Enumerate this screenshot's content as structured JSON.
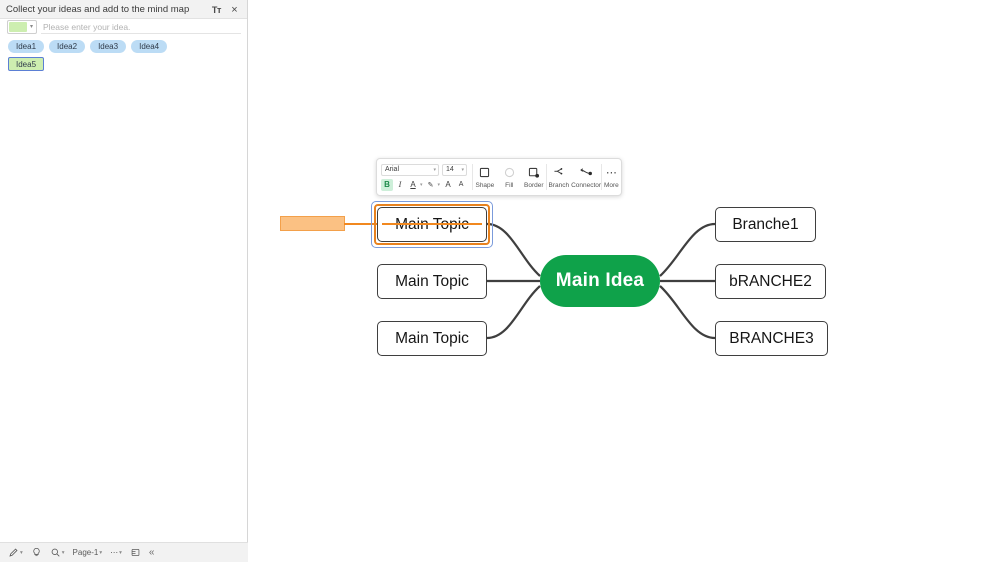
{
  "panel": {
    "title": "Collect your ideas and add to the mind map",
    "text_format_icon": "text-format-icon",
    "text_format_label": "Tт",
    "close_label": "×",
    "color_caret": "▾",
    "input_placeholder": "Please enter your idea.",
    "input_value": "",
    "swatch_color": "#cdeeb0",
    "chips": [
      {
        "label": "Idea1",
        "style": "blue"
      },
      {
        "label": "Idea2",
        "style": "blue"
      },
      {
        "label": "Idea3",
        "style": "blue"
      },
      {
        "label": "Idea4",
        "style": "blue"
      },
      {
        "label": "Idea5",
        "style": "green-selected"
      }
    ]
  },
  "status_bar": {
    "pen_label": "pen-icon",
    "pen_caret": "▾",
    "bulb_label": "lightbulb-icon",
    "zoom_label": "zoom-icon",
    "zoom_caret": "▾",
    "page_label": "Page-1",
    "page_caret": "▾",
    "more_label": "⋯",
    "more_caret": "▾",
    "layout_label": "page-layout-icon",
    "collapse_label": "«"
  },
  "toolbar": {
    "font_family": "Arial",
    "font_size": "14",
    "caret": "▾",
    "bold_label": "B",
    "italic_label": "I",
    "font_color_label": "A",
    "highlight_label": "✎",
    "increase_font_label": "A",
    "decrease_font_label": "A",
    "shape_label": "Shape",
    "fill_label": "Fill",
    "border_label": "Border",
    "branch_label": "Branch",
    "connector_label": "Connector",
    "more_label": "More",
    "more_glyph": "⋯"
  },
  "mindmap": {
    "center": {
      "label": "Main Idea",
      "color": "#0fa24a",
      "text_color": "#ffffff"
    },
    "left_nodes": [
      {
        "label": "Main Topic",
        "selected": true
      },
      {
        "label": "Main Topic",
        "selected": false
      },
      {
        "label": "Main Topic",
        "selected": false
      }
    ],
    "right_nodes": [
      {
        "label": "Branche1"
      },
      {
        "label": "bRANCHE2"
      },
      {
        "label": "BRANCHE3"
      }
    ],
    "selection": {
      "outer_color": "#7b9bdb",
      "inner_color": "#e8821f"
    },
    "drag_handle": {
      "fill": "#fbc183",
      "stroke": "#f3a04a",
      "line_color": "#f1881f"
    }
  }
}
